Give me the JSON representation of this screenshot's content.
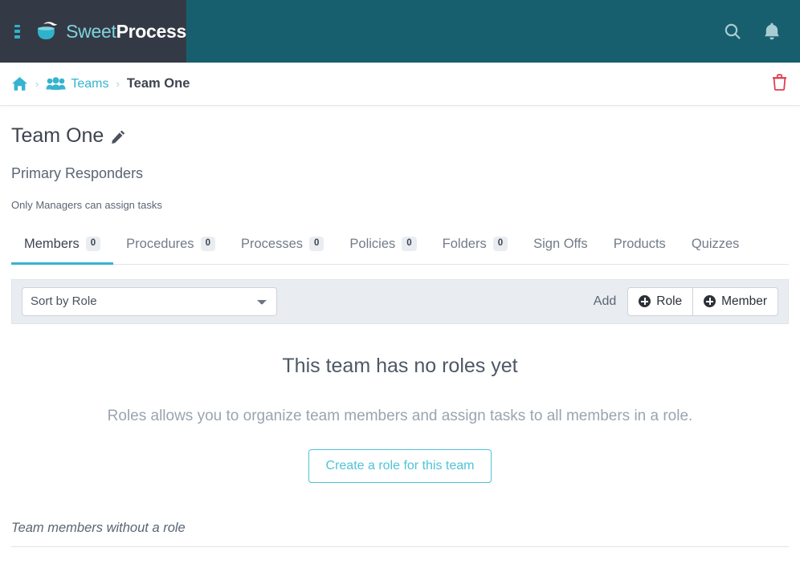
{
  "navbar": {
    "menu_icon": "hamburger-menu-icon",
    "brand_icon": "coffee-cup-logo-icon",
    "brand_first": "Sweet",
    "brand_second": "Process",
    "search_icon": "search-icon",
    "notification_icon": "bell-icon",
    "bg_color": "#175f6e",
    "panel_color": "#343a45",
    "accent_color": "#2fb3cc"
  },
  "breadcrumb": {
    "home_icon": "home-icon",
    "separator": "›",
    "teams_icon": "users-group-icon",
    "teams_label": "Teams",
    "current_label": "Team One",
    "delete_icon": "trash-icon",
    "delete_color": "#e03e52",
    "link_color": "#35b4cf"
  },
  "page": {
    "title": "Team One",
    "edit_icon": "pencil-icon",
    "subtitle": "Primary Responders",
    "note": "Only Managers can assign tasks"
  },
  "tabs": [
    {
      "label": "Members",
      "badge": "0",
      "active": true
    },
    {
      "label": "Procedures",
      "badge": "0",
      "active": false
    },
    {
      "label": "Processes",
      "badge": "0",
      "active": false
    },
    {
      "label": "Policies",
      "badge": "0",
      "active": false
    },
    {
      "label": "Folders",
      "badge": "0",
      "active": false
    },
    {
      "label": "Sign Offs",
      "badge": null,
      "active": false
    },
    {
      "label": "Products",
      "badge": null,
      "active": false
    },
    {
      "label": "Quizzes",
      "badge": null,
      "active": false
    }
  ],
  "toolbar": {
    "sort_selected": "Sort by Role",
    "sort_options": [
      "Sort by Role"
    ],
    "add_label": "Add",
    "add_role_label": "Role",
    "add_member_label": "Member",
    "plus_icon": "plus-circle-icon"
  },
  "empty_state": {
    "title": "This team has no roles yet",
    "description": "Roles allows you to organize team members and assign tasks to all members in a role.",
    "cta_label": "Create a role for this team",
    "cta_color": "#4ec3d9"
  },
  "footer_section": {
    "label": "Team members without a role"
  }
}
